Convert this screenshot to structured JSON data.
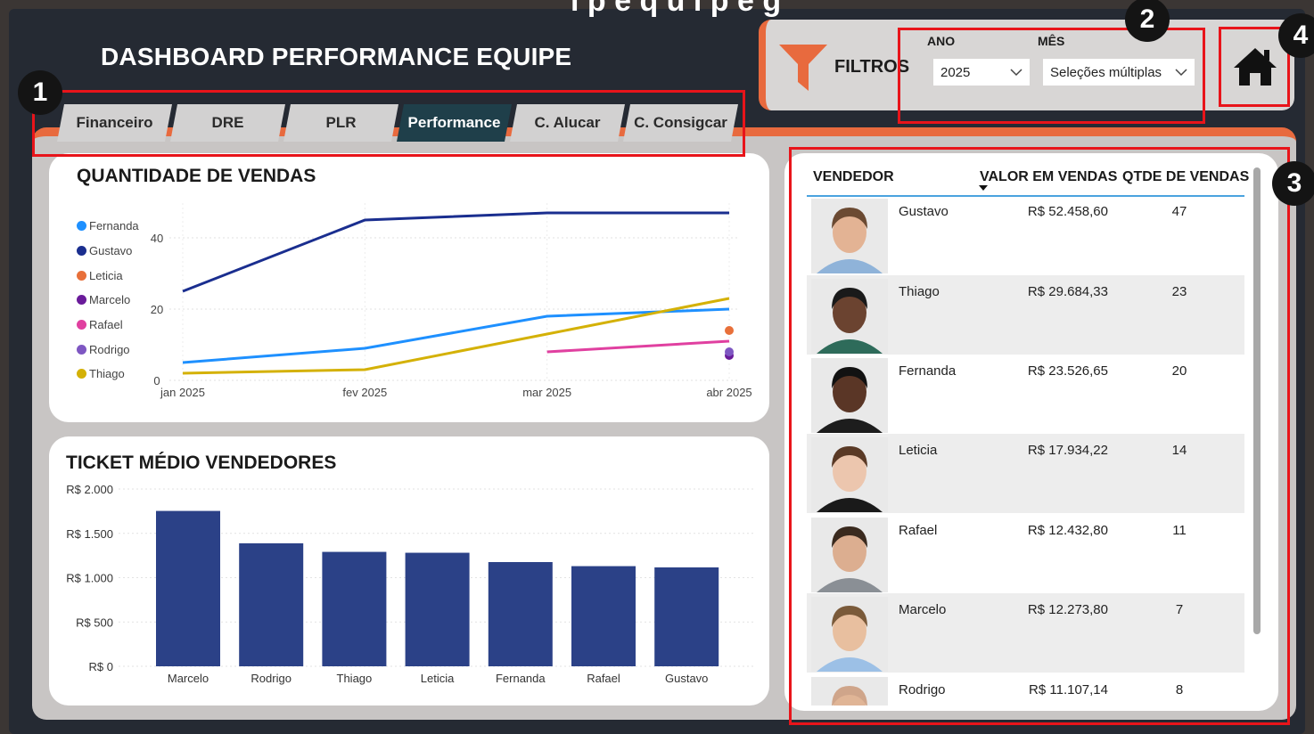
{
  "header": {
    "title": "DASHBOARD PERFORMANCE EQUIPE",
    "cut_title": "i p e q u i p e g"
  },
  "badges": [
    "1",
    "2",
    "3",
    "4"
  ],
  "tabs": [
    {
      "label": "Financeiro",
      "active": false
    },
    {
      "label": "DRE",
      "active": false
    },
    {
      "label": "PLR",
      "active": false
    },
    {
      "label": "Performance",
      "active": true
    },
    {
      "label": "C. Alucar",
      "active": false
    },
    {
      "label": "C. Consigcar",
      "active": false
    }
  ],
  "filters": {
    "label": "FILTROS",
    "icon": "funnel-icon",
    "ano_label": "ANO",
    "ano_value": "2025",
    "mes_label": "MÊS",
    "mes_value": "Seleções múltiplas"
  },
  "home": {
    "icon": "home-icon"
  },
  "colors": {
    "accent": "#e86a3e",
    "bar": "#2b4187",
    "active_tab": "#1f3f4a",
    "highlight": "#e8141a"
  },
  "line_chart": {
    "title": "QUANTIDADE DE VENDAS",
    "legend": [
      "Fernanda",
      "Gustavo",
      "Leticia",
      "Marcelo",
      "Rafael",
      "Rodrigo",
      "Thiago"
    ]
  },
  "bar_chart": {
    "title": "TICKET MÉDIO VENDEDORES"
  },
  "chart_data": [
    {
      "type": "line",
      "title": "QUANTIDADE DE VENDAS",
      "x": [
        "jan 2025",
        "fev 2025",
        "mar 2025",
        "abr 2025"
      ],
      "yticks": [
        "0",
        "20",
        "40"
      ],
      "ylim": [
        0,
        50
      ],
      "grid": true,
      "legend_position": "left",
      "series": [
        {
          "name": "Fernanda",
          "color": "#1e90ff",
          "values": [
            5,
            9,
            18,
            20
          ]
        },
        {
          "name": "Gustavo",
          "color": "#1a2e8f",
          "values": [
            25,
            45,
            47,
            47
          ]
        },
        {
          "name": "Leticia",
          "color": "#e8703a",
          "values": [
            null,
            null,
            null,
            14
          ]
        },
        {
          "name": "Marcelo",
          "color": "#6a1b9a",
          "values": [
            null,
            null,
            null,
            7
          ]
        },
        {
          "name": "Rafael",
          "color": "#e040a0",
          "values": [
            null,
            null,
            8,
            11
          ]
        },
        {
          "name": "Rodrigo",
          "color": "#7e57c2",
          "values": [
            null,
            null,
            null,
            8
          ]
        },
        {
          "name": "Thiago",
          "color": "#d4b106",
          "values": [
            2,
            3,
            13,
            23
          ]
        }
      ]
    },
    {
      "type": "bar",
      "title": "TICKET MÉDIO VENDEDORES",
      "categories": [
        "Marcelo",
        "Rodrigo",
        "Thiago",
        "Leticia",
        "Fernanda",
        "Rafael",
        "Gustavo"
      ],
      "values": [
        1753,
        1388,
        1291,
        1281,
        1176,
        1130,
        1116
      ],
      "yticks": [
        "R$ 0",
        "R$ 500",
        "R$ 1.000",
        "R$ 1.500",
        "R$ 2.000"
      ],
      "ylim": [
        0,
        2000
      ],
      "grid": true
    }
  ],
  "table": {
    "headers": {
      "vendedor": "VENDEDOR",
      "valor": "VALOR EM VENDAS",
      "qtde": "QTDE DE VENDAS"
    },
    "rows": [
      {
        "name": "Gustavo",
        "valor": "R$ 52.458,60",
        "qtde": "47",
        "skin": "#e3b394",
        "hair": "#6b4a32",
        "shirt": "#8fb3d9"
      },
      {
        "name": "Thiago",
        "valor": "R$ 29.684,33",
        "qtde": "23",
        "skin": "#6b4330",
        "hair": "#1a1a1a",
        "shirt": "#2e6b5a"
      },
      {
        "name": "Fernanda",
        "valor": "R$ 23.526,65",
        "qtde": "20",
        "skin": "#5a3626",
        "hair": "#121212",
        "shirt": "#1d1d1d"
      },
      {
        "name": "Leticia",
        "valor": "R$ 17.934,22",
        "qtde": "14",
        "skin": "#ecc6ae",
        "hair": "#5a3a26",
        "shirt": "#1a1a1a"
      },
      {
        "name": "Rafael",
        "valor": "R$ 12.432,80",
        "qtde": "11",
        "skin": "#dcae90",
        "hair": "#3a2a1e",
        "shirt": "#8a8f95"
      },
      {
        "name": "Marcelo",
        "valor": "R$ 12.273,80",
        "qtde": "7",
        "skin": "#e8bf9f",
        "hair": "#7a5a3a",
        "shirt": "#9cc0e6"
      },
      {
        "name": "Rodrigo",
        "valor": "R$ 11.107,14",
        "qtde": "8",
        "skin": "#e0b596",
        "hair": "#cfa58a",
        "shirt": "#888"
      }
    ]
  }
}
